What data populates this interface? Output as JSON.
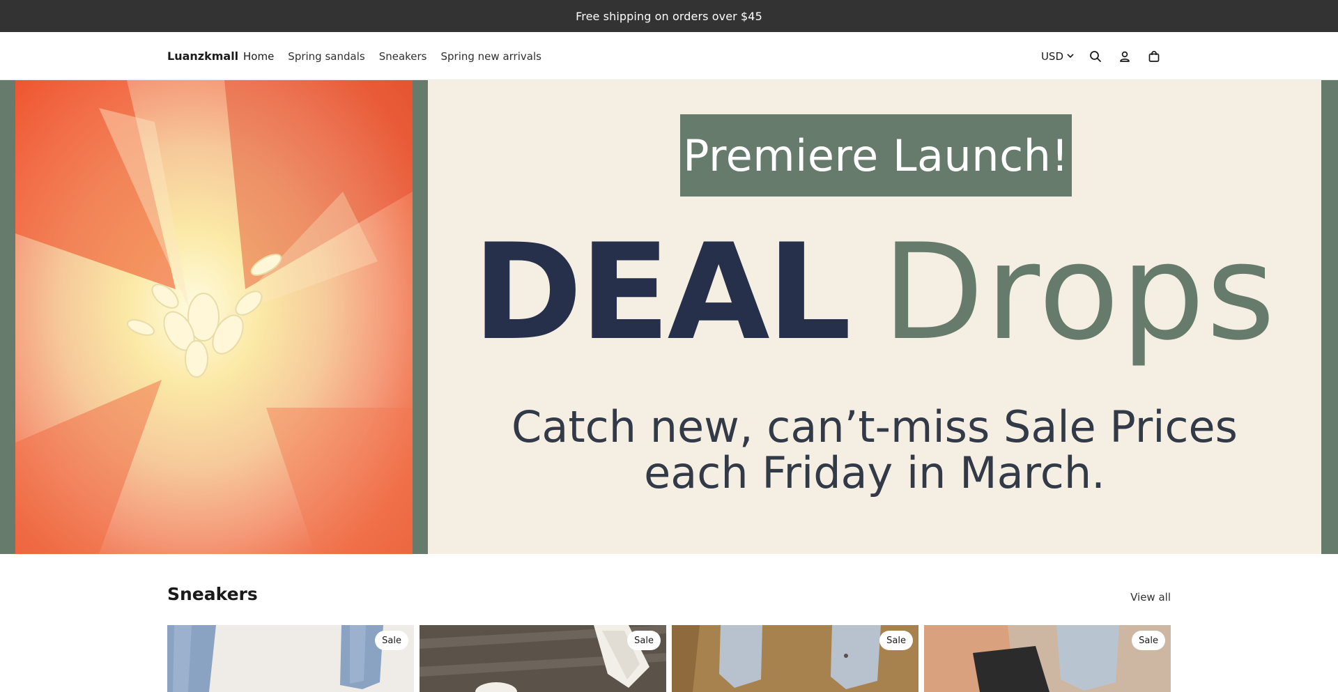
{
  "announcement": {
    "text": "Free shipping on orders over $45"
  },
  "header": {
    "logo": "Luanzkmall",
    "nav": [
      {
        "label": "Home"
      },
      {
        "label": "Spring sandals"
      },
      {
        "label": "Sneakers"
      },
      {
        "label": "Spring new arrivals"
      }
    ],
    "currency": "USD",
    "icons": [
      "search-icon",
      "account-icon",
      "cart-icon",
      "chevron-down-icon"
    ]
  },
  "hero": {
    "badge": "Premiere Launch!",
    "headline_word1": "DEAL",
    "headline_word2": "Drops",
    "subline1": "Catch new, can’t-miss Sale Prices",
    "subline2": "each Friday in March.",
    "colors": {
      "frame": "#677b6d",
      "panel": "#f5efe3",
      "navy": "#26304a"
    }
  },
  "section": {
    "title": "Sneakers",
    "view_all": "View all",
    "products": [
      {
        "badge": "Sale"
      },
      {
        "badge": "Sale"
      },
      {
        "badge": "Sale"
      },
      {
        "badge": "Sale"
      }
    ]
  }
}
